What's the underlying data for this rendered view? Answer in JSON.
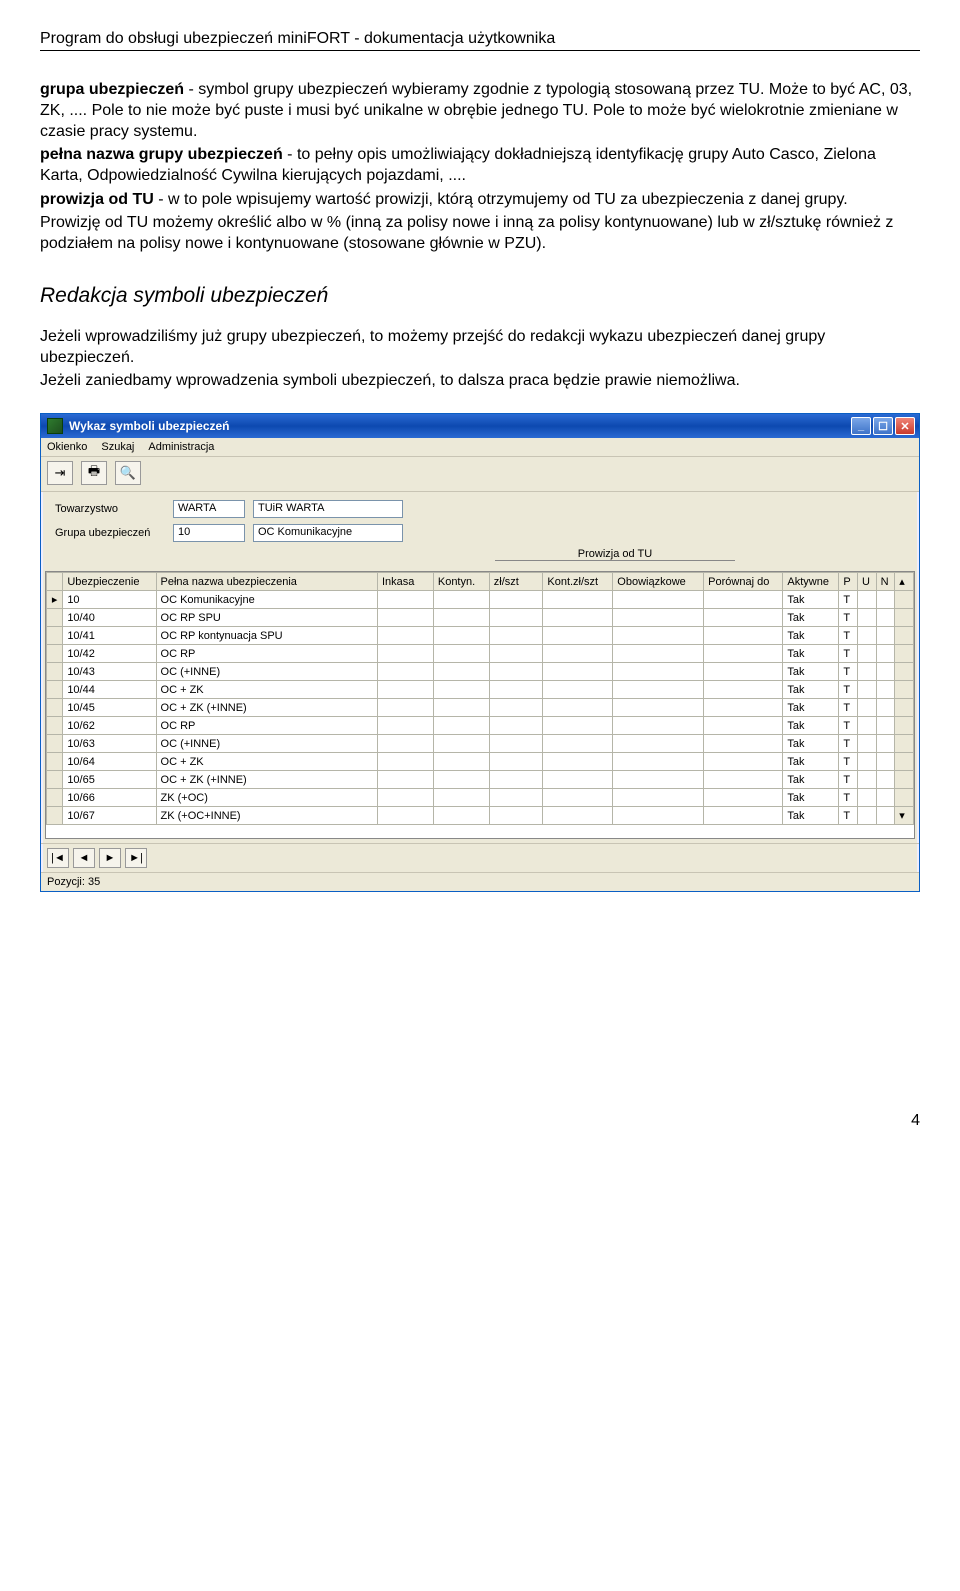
{
  "doc": {
    "header": "Program do obsługi ubezpieczeń miniFORT - dokumentacja użytkownika",
    "page_number": "4",
    "para1_bold": "grupa ubezpieczeń",
    "para1_rest": " - symbol grupy ubezpieczeń wybieramy zgodnie z typologią stosowaną przez TU. Może to być AC, 03, ZK, .... Pole to nie może być puste i musi być unikalne w obrębie jednego TU. Pole to może być wielokrotnie zmieniane w czasie pracy systemu.",
    "para2_bold": "pełna nazwa grupy ubezpieczeń",
    "para2_rest": " - to pełny opis umożliwiający dokładniejszą identyfikację grupy Auto Casco, Zielona Karta, Odpowiedzialność Cywilna kierujących pojazdami, ....",
    "para3_bold": "prowizja od TU",
    "para3_rest": " - w to pole wpisujemy wartość prowizji, którą otrzymujemy od TU za ubezpieczenia z danej grupy.",
    "para4": "Prowizję od TU możemy określić albo w % (inną za polisy nowe i inną za polisy kontynuowane) lub w zł/sztukę również z podziałem na polisy nowe i kontynuowane (stosowane głównie w PZU).",
    "heading": "Redakcja symboli ubezpieczeń",
    "para5": "Jeżeli wprowadziliśmy już grupy ubezpieczeń, to możemy przejść do redakcji wykazu ubezpieczeń danej grupy ubezpieczeń.",
    "para6": "Jeżeli zaniedbamy wprowadzenia symboli ubezpieczeń, to dalsza praca będzie prawie niemożliwa."
  },
  "win": {
    "title": "Wykaz symboli ubezpieczeń",
    "menu": {
      "okienko": "Okienko",
      "szukaj": "Szukaj",
      "administracja": "Administracja"
    },
    "form": {
      "label_tw": "Towarzystwo",
      "tw_code": "WARTA",
      "tw_name": "TUiR WARTA",
      "label_grupa": "Grupa ubezpieczeń",
      "gr_code": "10",
      "gr_name": "OC Komunikacyjne",
      "prowizja_label": "Prowizja od TU"
    },
    "headers": {
      "ubez": "Ubezpieczenie",
      "pelna": "Pełna nazwa ubezpieczenia",
      "inkasa": "Inkasa",
      "kontyn": "Kontyn.",
      "zlszt": "zł/szt",
      "kontzl": "Kont.zł/szt",
      "obow": "Obowiązkowe",
      "porow": "Porównaj do",
      "akt": "Aktywne",
      "p": "P",
      "u": "U",
      "n": "N"
    },
    "rows": [
      {
        "ubez": "10",
        "pelna": "OC Komunikacyjne",
        "akt": "Tak",
        "p": "T"
      },
      {
        "ubez": "10/40",
        "pelna": "OC RP SPU",
        "akt": "Tak",
        "p": "T"
      },
      {
        "ubez": "10/41",
        "pelna": "OC RP kontynuacja SPU",
        "akt": "Tak",
        "p": "T"
      },
      {
        "ubez": "10/42",
        "pelna": "OC RP",
        "akt": "Tak",
        "p": "T"
      },
      {
        "ubez": "10/43",
        "pelna": "OC (+INNE)",
        "akt": "Tak",
        "p": "T"
      },
      {
        "ubez": "10/44",
        "pelna": "OC + ZK",
        "akt": "Tak",
        "p": "T"
      },
      {
        "ubez": "10/45",
        "pelna": "OC + ZK (+INNE)",
        "akt": "Tak",
        "p": "T"
      },
      {
        "ubez": "10/62",
        "pelna": "OC RP",
        "akt": "Tak",
        "p": "T"
      },
      {
        "ubez": "10/63",
        "pelna": "OC (+INNE)",
        "akt": "Tak",
        "p": "T"
      },
      {
        "ubez": "10/64",
        "pelna": "OC + ZK",
        "akt": "Tak",
        "p": "T"
      },
      {
        "ubez": "10/65",
        "pelna": "OC + ZK (+INNE)",
        "akt": "Tak",
        "p": "T"
      },
      {
        "ubez": "10/66",
        "pelna": "ZK (+OC)",
        "akt": "Tak",
        "p": "T"
      },
      {
        "ubez": "10/67",
        "pelna": "ZK (+OC+INNE)",
        "akt": "Tak",
        "p": "T"
      }
    ],
    "nav": {
      "first": "|◄",
      "prev": "◄",
      "next": "►",
      "last": "►|"
    },
    "status": "Pozycji: 35"
  }
}
